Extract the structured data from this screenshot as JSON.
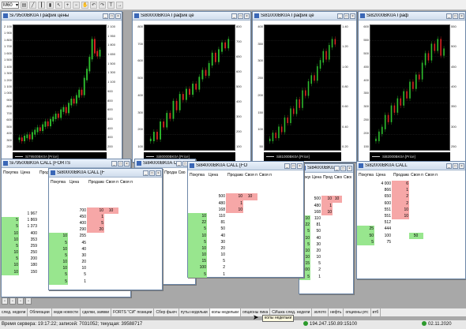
{
  "toolbar": {
    "timeframe": "M60"
  },
  "charts": [
    {
      "title": "Si79500BK0A График цены",
      "legend": "Si79500BK0A [Price]",
      "left_ticks": [
        "2 100",
        "1 900",
        "1 800",
        "1 700",
        "1 600",
        "1 500",
        "1 400",
        "1 300",
        "1 200",
        "1 100",
        "1 000",
        "900",
        "800",
        "700",
        "600",
        "500",
        "400",
        "300",
        "200"
      ],
      "right_ticks": [
        "2 100",
        "1 950",
        "1 800",
        "1 650",
        "1 500",
        "1 300",
        "1 100",
        "900",
        "800",
        "600",
        "500",
        "400",
        "300",
        "200"
      ],
      "series": [
        250,
        230,
        280,
        300,
        260,
        340,
        380,
        420,
        400,
        470,
        520,
        480,
        560,
        600,
        650,
        620,
        720,
        760,
        700,
        830,
        900,
        860,
        960,
        1050,
        1000,
        1250,
        1400,
        1600,
        1900,
        1700,
        1650,
        1720
      ]
    },
    {
      "title": "Si80000BK0A График це",
      "legend": "Si80000BK0A [Price]",
      "left_ticks": [
        "800",
        "700",
        "600",
        "500",
        "400",
        "300",
        "200",
        "100"
      ],
      "right_ticks": [
        "800",
        "700",
        "650",
        "600",
        "500",
        "400",
        "300",
        "200",
        "100"
      ],
      "series": [
        200,
        240,
        210,
        300,
        280,
        350,
        330,
        420,
        380,
        460,
        440,
        490,
        470,
        520,
        500,
        560,
        600,
        580,
        640,
        700,
        660,
        720,
        760,
        740,
        780
      ]
    },
    {
      "title": "Si81000BK0A График це",
      "legend": "Si81000BK0A [Price]",
      "left_ticks": [
        "400",
        "350",
        "300",
        "250",
        "200",
        "150",
        "100",
        "50"
      ],
      "right_ticks": [
        "1.40",
        "1.20",
        "1.00",
        "0.80",
        "0.60",
        "0.40",
        "0.20"
      ],
      "series": [
        40,
        60,
        50,
        80,
        70,
        110,
        100,
        140,
        130,
        170,
        150,
        200,
        190,
        230,
        250,
        240,
        280,
        300,
        330,
        310,
        350,
        370,
        360
      ]
    },
    {
      "title": "Si82000BK0A Граф",
      "legend": "Si82000BK0A [Price]",
      "left_ticks": [
        "600",
        "550",
        "500",
        "450",
        "400",
        "350",
        "300",
        "250",
        "200",
        "150"
      ],
      "right_ticks": [
        "550",
        "500",
        "450",
        "400",
        "350",
        "300",
        "250"
      ],
      "series": [
        160,
        190,
        210,
        260,
        240,
        300,
        280,
        330,
        310,
        360,
        340,
        400,
        380,
        430,
        420,
        480,
        520,
        500,
        560,
        540,
        580,
        520,
        540
      ]
    }
  ],
  "orderbooks": [
    {
      "title": "Si79500BK0A CALL [FORTS",
      "headers": [
        "Покупка",
        "Цена",
        "Продажа",
        "Своя п"
      ],
      "rows": [
        [
          "",
          "",
          "",
          ""
        ],
        [
          "",
          "",
          "",
          ""
        ],
        [
          "",
          "",
          "",
          ""
        ],
        [
          "",
          "",
          "",
          ""
        ],
        [
          "",
          "",
          "",
          ""
        ],
        [
          "",
          "1 967",
          "",
          ""
        ],
        [
          "5",
          "1 869",
          "",
          ""
        ],
        [
          "5",
          "1 373",
          "",
          ""
        ],
        [
          "10",
          "400",
          "",
          ""
        ],
        [
          "10",
          "353",
          "",
          ""
        ],
        [
          "5",
          "259",
          "",
          ""
        ],
        [
          "10",
          "250",
          "",
          ""
        ],
        [
          "5",
          "200",
          "",
          ""
        ],
        [
          "10",
          "180",
          "",
          ""
        ],
        [
          "10",
          "150",
          "",
          ""
        ]
      ],
      "sell_rows": 5,
      "buy_start": 6
    },
    {
      "title": "Si80000BK0A CALL [F",
      "headers": [
        "Покупка",
        "Цена",
        "Продажа",
        "Своя по",
        "Своя пр"
      ],
      "rows": [
        [
          "",
          "",
          "",
          ""
        ],
        [
          "",
          "",
          "",
          ""
        ],
        [
          "",
          "",
          "",
          ""
        ],
        [
          "",
          "700",
          "10",
          "10"
        ],
        [
          "",
          "450",
          "1",
          ""
        ],
        [
          "",
          "400",
          "5",
          ""
        ],
        [
          "",
          "290",
          "20",
          ""
        ],
        [
          "10",
          "255",
          "",
          ""
        ],
        [
          "5",
          "45",
          "",
          ""
        ],
        [
          "10",
          "40",
          "",
          ""
        ],
        [
          "5",
          "30",
          "",
          ""
        ],
        [
          "10",
          "20",
          "",
          ""
        ],
        [
          "10",
          "10",
          "",
          ""
        ],
        [
          "5",
          "5",
          "",
          ""
        ],
        [
          "5",
          "1",
          "",
          ""
        ]
      ],
      "sell_rows": 7,
      "buy_start": 7
    },
    {
      "title": "Si84000BK0A CALL [FORTS",
      "headers": [
        "Покупка",
        "Цена",
        "Продажа",
        "Своя по",
        "Своя пр"
      ],
      "rows": [
        [
          "",
          "1 880",
          "",
          ""
        ],
        [
          "",
          "1 690",
          "",
          ""
        ],
        [
          "",
          "1 675",
          "",
          ""
        ],
        [
          "",
          "1 651",
          "",
          ""
        ],
        [
          "",
          "1 602",
          "",
          ""
        ],
        [
          "",
          "1 570",
          "",
          ""
        ],
        [
          "",
          "1 497",
          "",
          ""
        ],
        [
          "",
          "1 494",
          "",
          ""
        ],
        [
          "",
          "1 350",
          "",
          ""
        ],
        [
          "",
          "50",
          "",
          ""
        ],
        [
          "",
          "1",
          "",
          ""
        ]
      ],
      "sell_rows": 0,
      "buy_start": 6
    },
    {
      "title": "Si84000BK0A CALL [FO",
      "headers": [
        "Покупка",
        "Цена",
        "Продажа",
        "Своя по",
        "Своя пр"
      ],
      "rows": [
        [
          "",
          "",
          "",
          ""
        ],
        [
          "",
          "",
          "",
          ""
        ],
        [
          "",
          "500",
          "10",
          "10"
        ],
        [
          "",
          "480",
          "1",
          ""
        ],
        [
          "",
          "168",
          "10",
          ""
        ],
        [
          "10",
          "110",
          "",
          ""
        ],
        [
          "22",
          "81",
          "",
          ""
        ],
        [
          "5",
          "50",
          "",
          ""
        ],
        [
          "10",
          "40",
          "",
          ""
        ],
        [
          "5",
          "30",
          "",
          ""
        ],
        [
          "10",
          "20",
          "",
          ""
        ],
        [
          "10",
          "10",
          "",
          ""
        ],
        [
          "15",
          "5",
          "",
          ""
        ],
        [
          "100",
          "2",
          "",
          ""
        ],
        [
          "5",
          "1",
          "",
          ""
        ]
      ],
      "sell_rows": 5,
      "buy_start": 5
    },
    {
      "title": "Si82000BK0A CALL",
      "headers": [
        "Покупка",
        "Цена",
        "Продажа",
        "Своя по",
        "Своя пр"
      ],
      "rows": [
        [
          "",
          "4 000",
          "6",
          ""
        ],
        [
          "",
          "866",
          "1",
          ""
        ],
        [
          "",
          "650",
          "2",
          ""
        ],
        [
          "",
          "600",
          "2",
          ""
        ],
        [
          "",
          "551",
          "10",
          ""
        ],
        [
          "",
          "551",
          "10",
          ""
        ],
        [
          "",
          "512",
          "",
          ""
        ],
        [
          "25",
          "444",
          "",
          ""
        ],
        [
          "50",
          "100",
          "",
          "50"
        ],
        [
          "5",
          "75",
          "",
          ""
        ]
      ],
      "sell_rows": 6,
      "buy_start": 6
    }
  ],
  "tabs": [
    "след. недели",
    "Облигации",
    "хедж новости",
    "сделки, заявки",
    "FORTS \"СИ\" позиции",
    "Сбер фьюч",
    "путы недельки",
    "колы недельки",
    "опционы пика",
    "СИшка след. недели",
    "золото",
    "нефть",
    "опционы ртс",
    "втб"
  ],
  "active_tab": "колы недельки",
  "tooltip": "колы недельки",
  "status": {
    "time": "Время сервера: 19:17:22; записей: 7031052; текущая: 39588717",
    "ip": "194.247.150.89:15100",
    "date": "02.11.2020"
  }
}
